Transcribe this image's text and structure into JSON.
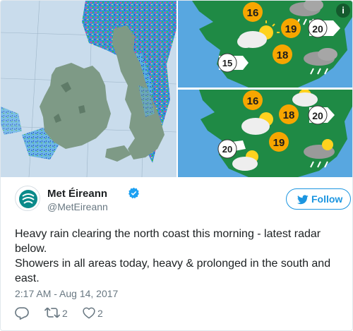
{
  "media": {
    "forecast_top": {
      "temps": [
        "16",
        "19",
        "20",
        "18",
        "15"
      ]
    },
    "forecast_bottom": {
      "temps": [
        "16",
        "18",
        "20",
        "19",
        "20"
      ]
    },
    "info_glyph": "i"
  },
  "tweet": {
    "author_name": "Met Éireann",
    "handle": "@MetEireann",
    "follow_label": "Follow",
    "text_line_1": "Heavy rain clearing the north coast this morning - latest radar below.",
    "text_line_2": "Showers in all areas today, heavy & prolonged in the south and east.",
    "timestamp": "2:17 AM - Aug 14, 2017",
    "retweet_count": "2",
    "like_count": "2"
  },
  "icons": {
    "avatar": "met-eireann-logo",
    "verified": "verified-badge-icon",
    "follow": "twitter-bird-icon",
    "reply": "reply-icon",
    "retweet": "retweet-icon",
    "like": "heart-icon"
  },
  "colors": {
    "accent": "#1b95e0",
    "text": "#1c2022",
    "secondary_text": "#697882",
    "sea": "#58a7e0",
    "land": "#1f8a45",
    "temp_badge": "#f7a600"
  }
}
